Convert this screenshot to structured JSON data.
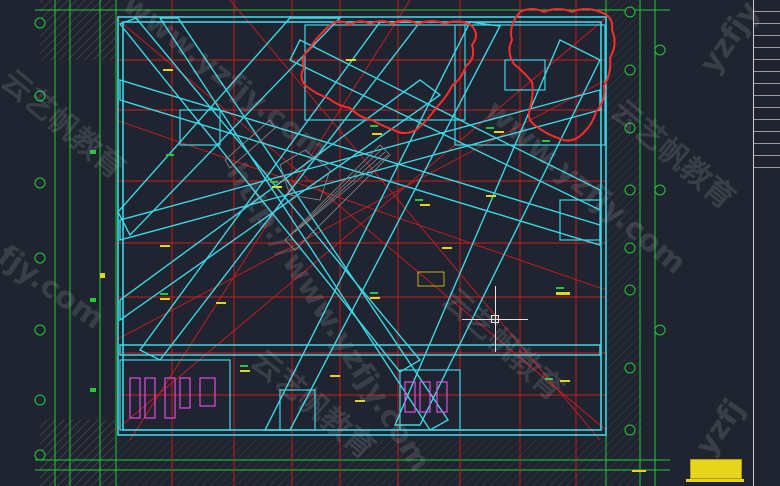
{
  "app": {
    "title": "AutoCAD floor plan drawing",
    "background": "#1f2430"
  },
  "colors": {
    "wall": "#3ad7e6",
    "grid": "#e02020",
    "dim": "#24c93a",
    "hatch": "#7a7a7a",
    "text": "#e6d51a",
    "revision": "#ff2a2a",
    "fixture": "#e04be0"
  },
  "watermarks": {
    "url_1": "www.yzfjy.com",
    "url_2": "http://www.yzfjy.com",
    "url_3": "www.yzfjy.com",
    "cn_1": "云艺帆教育",
    "cn_2": "云艺帆教育",
    "cn_3": "云艺帆教育",
    "cn_4": "云艺帆教育",
    "url_4": "yzfjy",
    "url_5": "fjy.com",
    "url_6": "yzfj"
  },
  "annotations": {
    "note_1": "",
    "note_2": ""
  },
  "drawing": {
    "cursor": "crosshair-cursor",
    "title_block": "title-stamp"
  }
}
